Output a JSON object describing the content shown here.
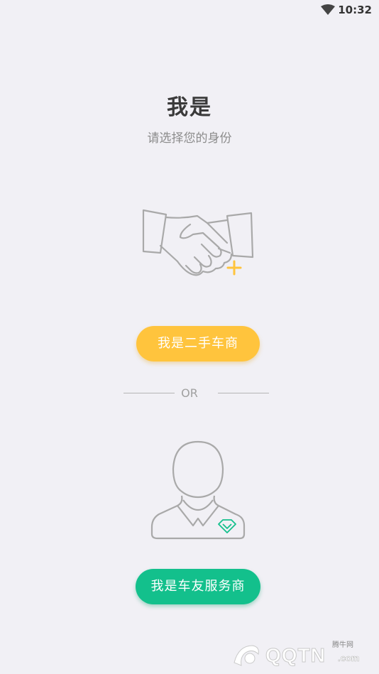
{
  "status_bar": {
    "time": "10:32",
    "icons": [
      "wifi-icon"
    ]
  },
  "header": {
    "title": "我是",
    "subtitle": "请选择您的身份"
  },
  "dealer": {
    "icon": "handshake-icon",
    "button_label": "我是二手车商",
    "accent": "#ffc43d"
  },
  "divider": {
    "label": "OR"
  },
  "service": {
    "icon": "person-icon",
    "button_label": "我是车友服务商",
    "accent": "#13c08c"
  },
  "watermark": {
    "brand": "QQTN",
    "domain": ".com",
    "tag": "腾牛网"
  }
}
